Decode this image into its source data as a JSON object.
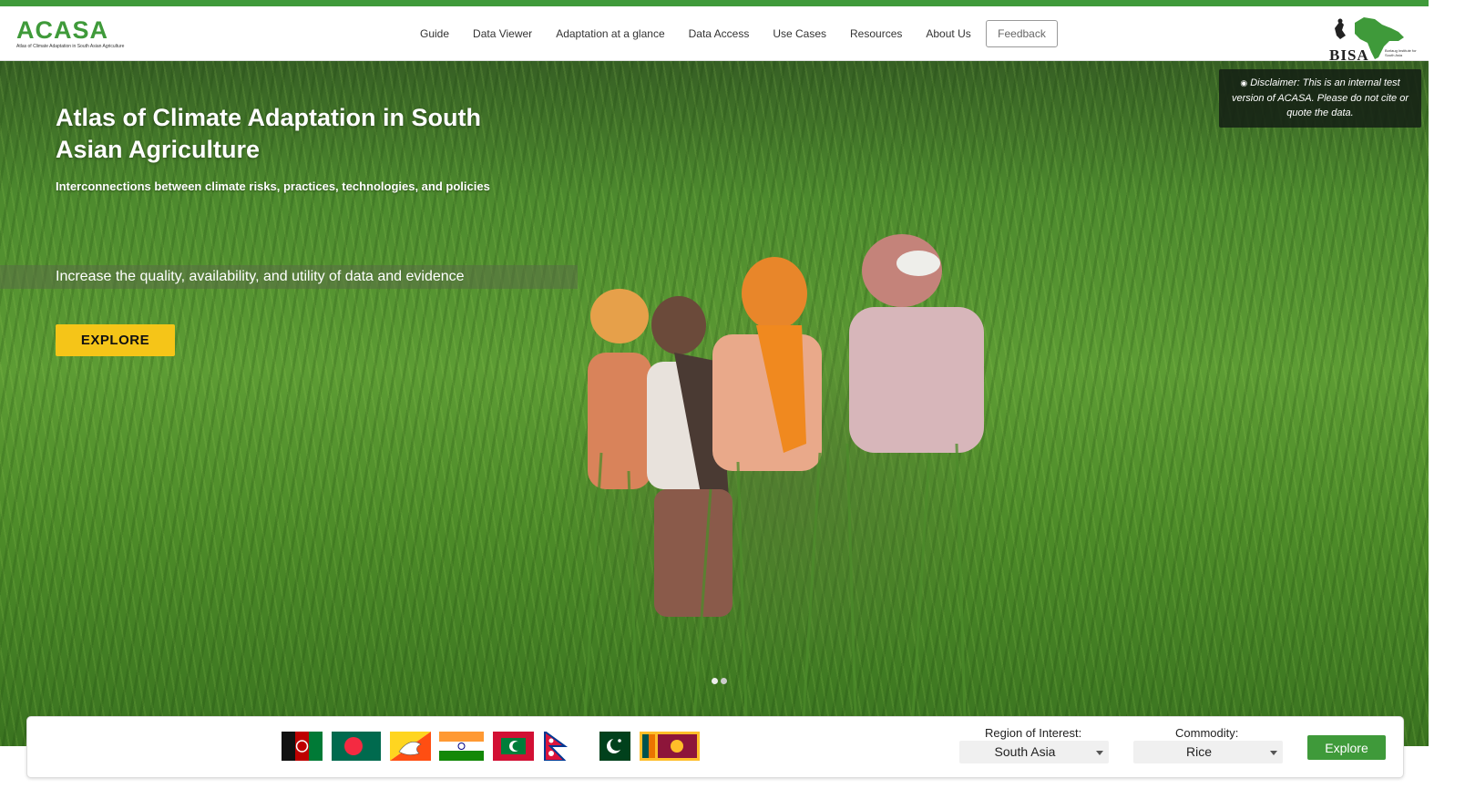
{
  "header": {
    "logo_text": "ACASA",
    "logo_tagline": "Atlas of Climate Adaptation in South Asian Agriculture",
    "nav": [
      "Guide",
      "Data Viewer",
      "Adaptation at a glance",
      "Data Access",
      "Use Cases",
      "Resources",
      "About Us"
    ],
    "feedback_label": "Feedback",
    "partner_logo_text": "BISA",
    "partner_tagline": "Borlaug Institute for South Asia"
  },
  "hero": {
    "title": "Atlas of Climate Adaptation in South Asian Agriculture",
    "subtitle": "Interconnections between climate risks, practices, technologies, and policies",
    "band_text": "Increase the quality, availability, and utility of data and evidence",
    "explore_label": "EXPLORE",
    "disclaimer": "Disclaimer: This is an internal test version of ACASA. Please do not cite or quote the data.",
    "carousel_dots": 2,
    "active_dot": 1
  },
  "filter_panel": {
    "flags": [
      "afghanistan-flag",
      "bangladesh-flag",
      "bhutan-flag",
      "india-flag",
      "maldives-flag",
      "nepal-flag",
      "pakistan-flag",
      "sri-lanka-flag"
    ],
    "region_label": "Region of Interest:",
    "region_value": "South Asia",
    "commodity_label": "Commodity:",
    "commodity_value": "Rice",
    "explore_label": "Explore"
  },
  "colors": {
    "brand_green": "#3f9a3a",
    "accent_yellow": "#f5c518",
    "logo_orange": "#e8a21b"
  }
}
